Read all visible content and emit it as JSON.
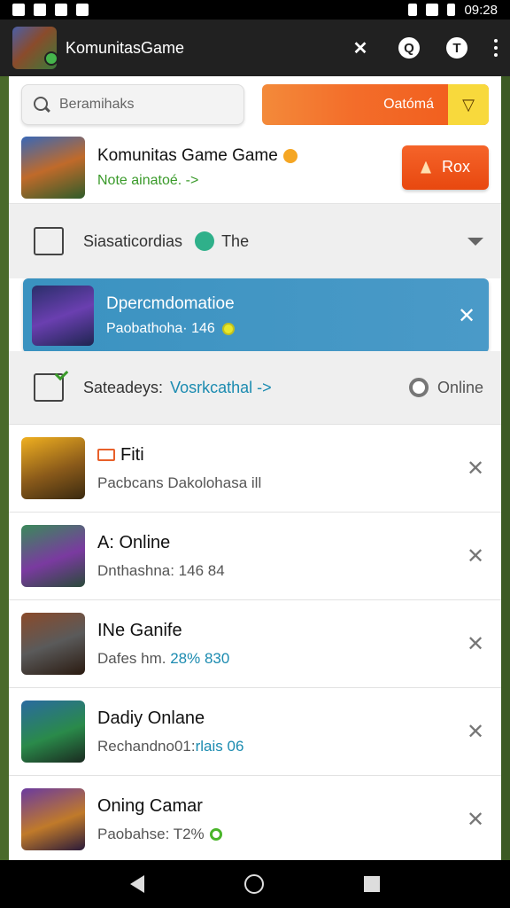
{
  "status_bar": {
    "time": "09:28"
  },
  "app_bar": {
    "title": "KomunitasGame"
  },
  "search": {
    "placeholder": "Beramihaks"
  },
  "category_button": {
    "label": "Oatómá"
  },
  "featured": {
    "title": "Komunitas Game Game",
    "subtitle": "Note ainatoé. ->",
    "button_label": "Rox"
  },
  "section_1": {
    "title": "Siasaticordias",
    "extra": "The"
  },
  "highlight": {
    "title": "Dpercmdomatioe",
    "subtitle": "Paobathoha· 146"
  },
  "section_2": {
    "title": "Sateadeys:",
    "link": "Vosrkcathal ->",
    "status": "Online"
  },
  "games": [
    {
      "title": "Fiti",
      "subtitle": "Pacbcans Dakolohasa ill",
      "accent": ""
    },
    {
      "title": "A: Online",
      "subtitle": "Dnthashna: 146 84",
      "accent": ""
    },
    {
      "title": "INe Ganife",
      "subtitle": "Dafes hm. ",
      "accent": "28% 830"
    },
    {
      "title": "Dadiy Onlane",
      "subtitle": "Rechandno01:",
      "accent": "rlais 06"
    },
    {
      "title": "Oning Camar",
      "subtitle": "Paobahse: T2%",
      "accent": ""
    }
  ],
  "icons": {
    "app": "game-avatar",
    "search": "search-icon",
    "close": "close-icon"
  },
  "colors": {
    "accent_orange": "#f15a1a",
    "highlight_blue": "#3a92c0",
    "link_teal": "#1b8bb0",
    "green": "#3a9a2a"
  }
}
